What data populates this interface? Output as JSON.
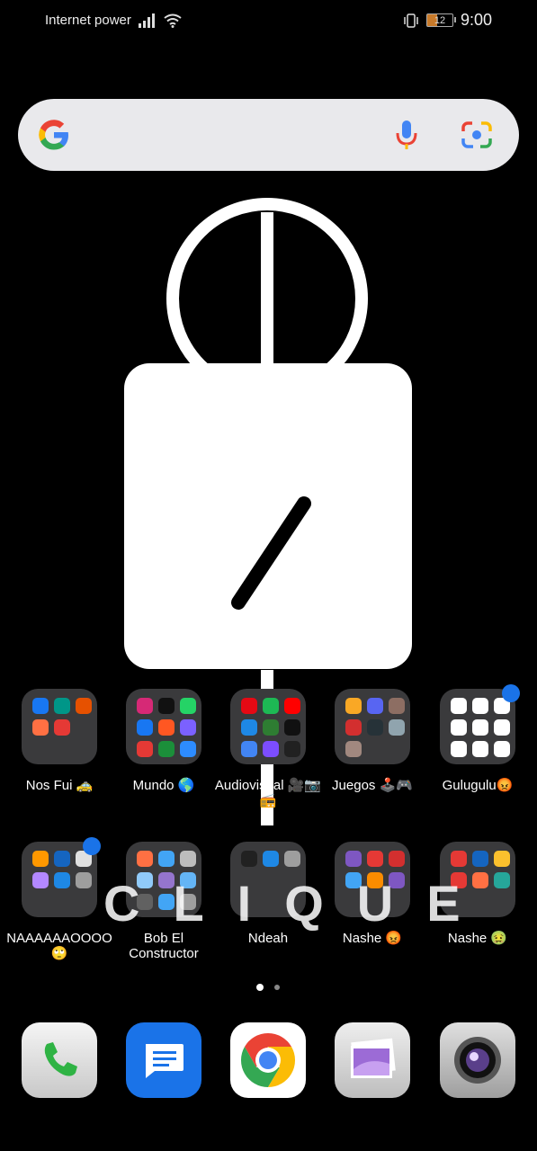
{
  "status_bar": {
    "carrier": "Internet power",
    "time": "9:00",
    "battery": "12"
  },
  "search": {
    "engine": "G"
  },
  "wallpaper": {
    "text": "CLIQUE"
  },
  "folders_row1": [
    {
      "label": "Nos Fui 🚕",
      "colors": [
        "#1877f2",
        "#009688",
        "#e65100",
        "#ff7043",
        "#e53935"
      ],
      "badge": false
    },
    {
      "label": "Mundo 🌎",
      "colors": [
        "#d62976",
        "#111111",
        "#25d366",
        "#1877f2",
        "#ff5722",
        "#7b61ff",
        "#e53935",
        "#1b8f3a",
        "#2d8cff"
      ],
      "badge": false
    },
    {
      "label": "Audiovisual 🎥📷📻",
      "colors": [
        "#e50914",
        "#1db954",
        "#ff0000",
        "#1e88e5",
        "#2e7d32",
        "#111111",
        "#4285f4",
        "#7c4dff",
        "#212121"
      ],
      "badge": false
    },
    {
      "label": "Juegos 🕹️🎮",
      "colors": [
        "#f9a825",
        "#5865f2",
        "#8d6e63",
        "#d32f2f",
        "#263238",
        "#90a4ae",
        "#a1887f"
      ],
      "badge": false
    },
    {
      "label": "Gulugulu😡",
      "colors": [
        "#ffffff",
        "#ffffff",
        "#ffffff",
        "#ffffff",
        "#ffffff",
        "#ffffff",
        "#ffffff",
        "#ffffff",
        "#ffffff"
      ],
      "badge": true
    }
  ],
  "folders_row2": [
    {
      "label": "NAAAAAAOOOO🙄",
      "colors": [
        "#ff9800",
        "#1565c0",
        "#e0e0e0",
        "#b388ff",
        "#1e88e5",
        "#9e9e9e"
      ],
      "badge": true
    },
    {
      "label": "Bob El Constructor",
      "colors": [
        "#ff7043",
        "#42a5f5",
        "#bdbdbd",
        "#90caf9",
        "#9575cd",
        "#64b5f6",
        "#616161",
        "#42a5f5",
        "#9e9e9e"
      ],
      "badge": false
    },
    {
      "label": "Ndeah",
      "colors": [
        "#212121",
        "#1e88e5",
        "#9e9e9e"
      ],
      "badge": false
    },
    {
      "label": "Nashe 😡",
      "colors": [
        "#7e57c2",
        "#e53935",
        "#d32f2f",
        "#42a5f5",
        "#fb8c00",
        "#7e57c2"
      ],
      "badge": false
    },
    {
      "label": "Nashe 🤢",
      "colors": [
        "#e53935",
        "#1565c0",
        "#fbc02d",
        "#e53935",
        "#ff7043",
        "#26a69a"
      ],
      "badge": false
    }
  ],
  "dock": [
    {
      "name": "phone"
    },
    {
      "name": "messages"
    },
    {
      "name": "chrome"
    },
    {
      "name": "gallery"
    },
    {
      "name": "camera"
    }
  ]
}
